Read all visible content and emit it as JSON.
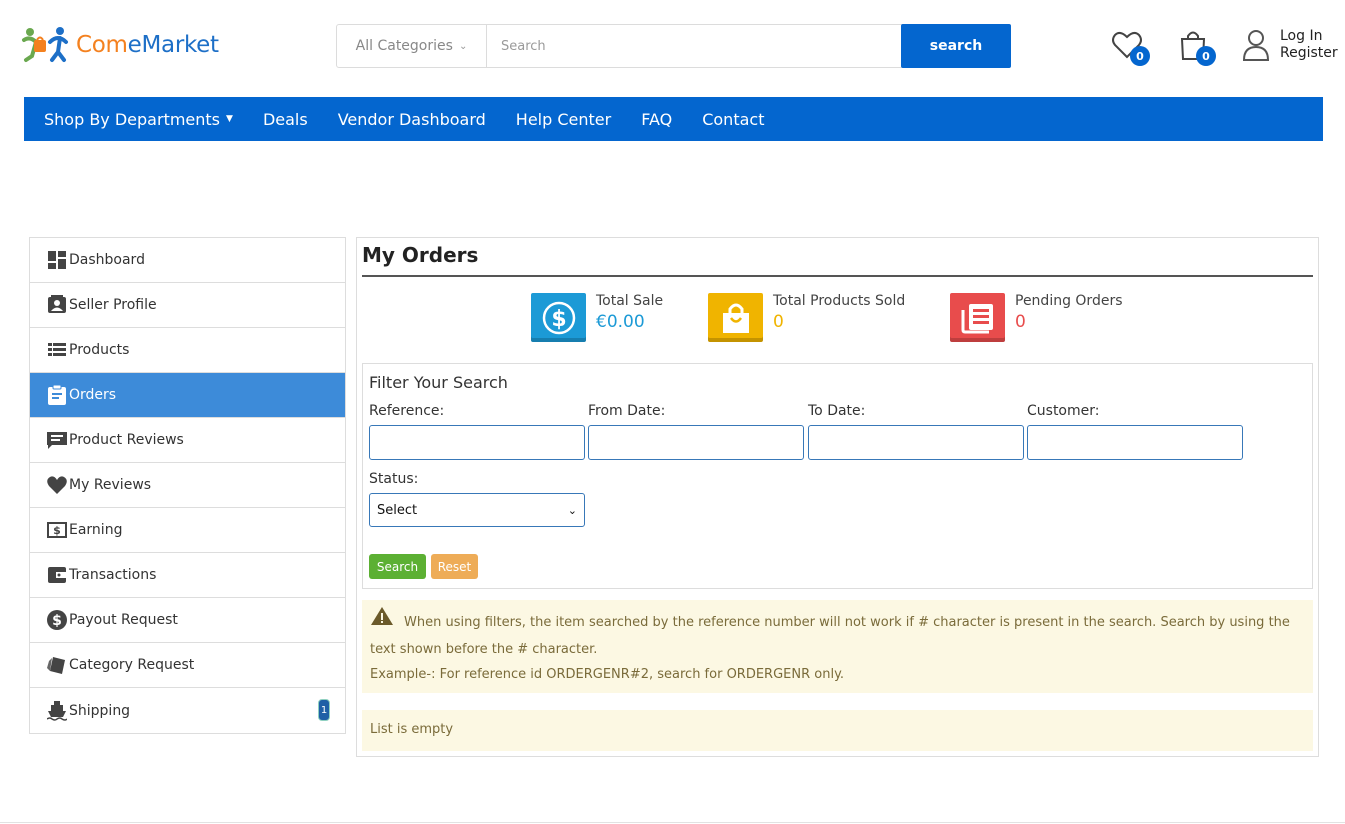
{
  "brand": {
    "part1": "Com",
    "part2": "eMarket"
  },
  "search": {
    "category": "All Categories",
    "placeholder": "Search",
    "button": "search"
  },
  "header": {
    "wishlist_count": "0",
    "cart_count": "0",
    "login": "Log In",
    "register": "Register"
  },
  "nav": {
    "departments": "Shop By Departments",
    "items": [
      "Deals",
      "Vendor Dashboard",
      "Help Center",
      "FAQ",
      "Contact"
    ]
  },
  "sidebar": {
    "items": [
      {
        "label": "Dashboard",
        "icon": "dashboard-icon"
      },
      {
        "label": "Seller Profile",
        "icon": "profile-icon"
      },
      {
        "label": "Products",
        "icon": "list-icon"
      },
      {
        "label": "Orders",
        "icon": "clipboard-icon",
        "active": true
      },
      {
        "label": "Product Reviews",
        "icon": "comment-icon"
      },
      {
        "label": "My Reviews",
        "icon": "heart-icon"
      },
      {
        "label": "Earning",
        "icon": "money-icon"
      },
      {
        "label": "Transactions",
        "icon": "wallet-icon"
      },
      {
        "label": "Payout Request",
        "icon": "dollar-circle-icon"
      },
      {
        "label": "Category Request",
        "icon": "tags-icon"
      },
      {
        "label": "Shipping",
        "icon": "ship-icon",
        "count": "1"
      }
    ]
  },
  "main": {
    "title": "My Orders",
    "stats": [
      {
        "label": "Total Sale",
        "value": "€0.00",
        "color": "#1c9ad6"
      },
      {
        "label": "Total Products Sold",
        "value": "0",
        "color": "#f0b400"
      },
      {
        "label": "Pending Orders",
        "value": "0",
        "color": "#e84c4c"
      }
    ],
    "filter": {
      "title": "Filter Your Search",
      "reference": "Reference:",
      "from_date": "From Date:",
      "to_date": "To Date:",
      "customer": "Customer:",
      "status": "Status:",
      "status_value": "Select",
      "search_btn": "Search",
      "reset_btn": "Reset"
    },
    "warning": {
      "line1": "When using filters, the item searched by the reference number will not work if # character is present in the search. Search by using the text shown before the # character.",
      "line2": "Example-: For reference id ORDERGENR#2, search for ORDERGENR only."
    },
    "empty": "List is empty"
  },
  "colors": {
    "primary": "#0466cf",
    "active": "#3d8bd9",
    "success": "#5cb033",
    "warning_btn": "#eeac57",
    "alert_bg": "#fcf8e3"
  }
}
